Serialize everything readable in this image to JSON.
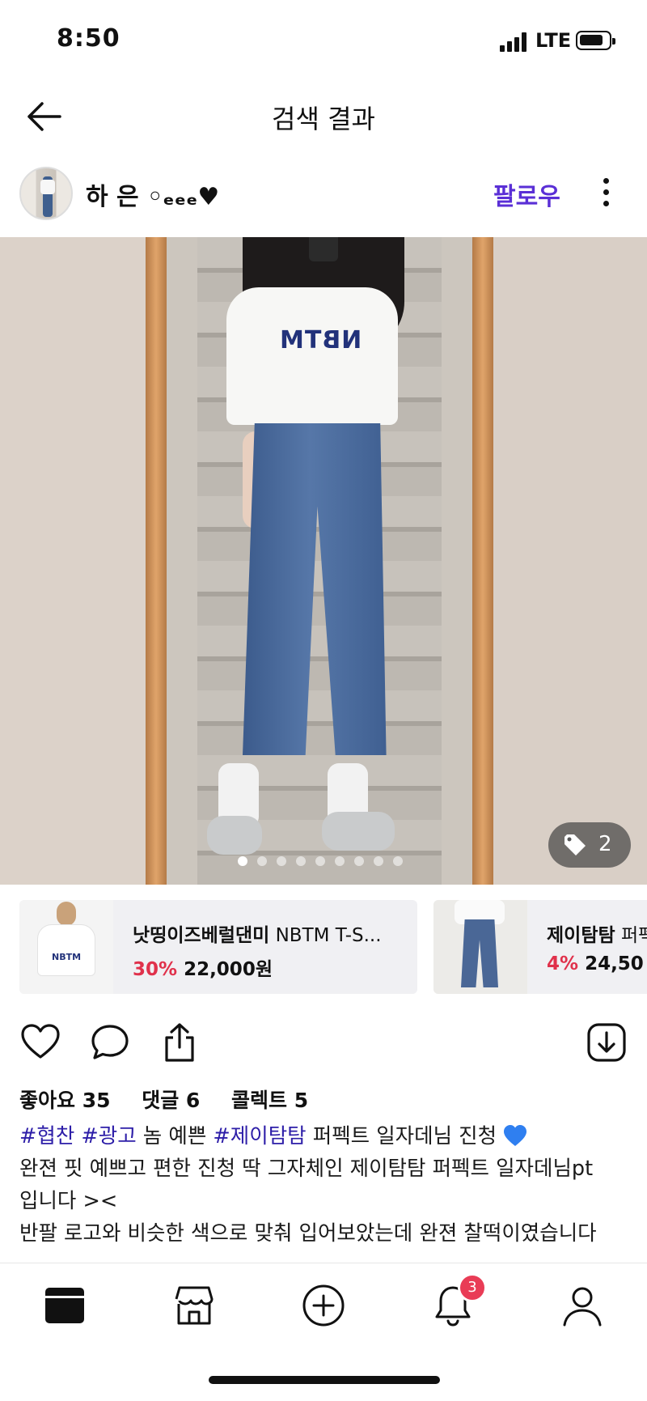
{
  "status_bar": {
    "time": "8:50",
    "network": "LTE"
  },
  "header": {
    "title": "검색 결과"
  },
  "author": {
    "name": "하 은 ◦ₑₑₑ♥",
    "follow_label": "팔로우"
  },
  "photo": {
    "tag_count": "2",
    "page_count": 9,
    "current_page": 1
  },
  "products": [
    {
      "brand": "낫띵이즈베럴댄미",
      "name": "NBTM T-S...",
      "discount": "30%",
      "price": "22,000원"
    },
    {
      "brand": "제이탐탐",
      "name": "퍼펙",
      "discount": "4%",
      "price": "24,50"
    }
  ],
  "stats": {
    "likes": "좋아요 35",
    "comments": "댓글 6",
    "collects": "콜렉트 5"
  },
  "caption": {
    "line1": {
      "tag1": "#협찬",
      "tag2": "#광고",
      "text1": " 놈 예쁜 ",
      "tag3": "#제이탐탐",
      "text2": " 퍼펙트 일자데님 진청 "
    },
    "line2": "완젼 핏 예쁘고 편한 진청 딱 그자체인 제이탐탐 퍼펙트 일자데님pt",
    "line3": "입니다 ><",
    "line4": "반팔 로고와 비슷한 색으로 맞춰 입어보았는데 완젼 찰떡이였습니다"
  },
  "bottom_nav": {
    "notification_count": "3"
  },
  "colors": {
    "accent": "#5a2fd6",
    "hashtag": "#2d1ea8",
    "discount": "#e0314b",
    "badge": "#e93c56"
  }
}
